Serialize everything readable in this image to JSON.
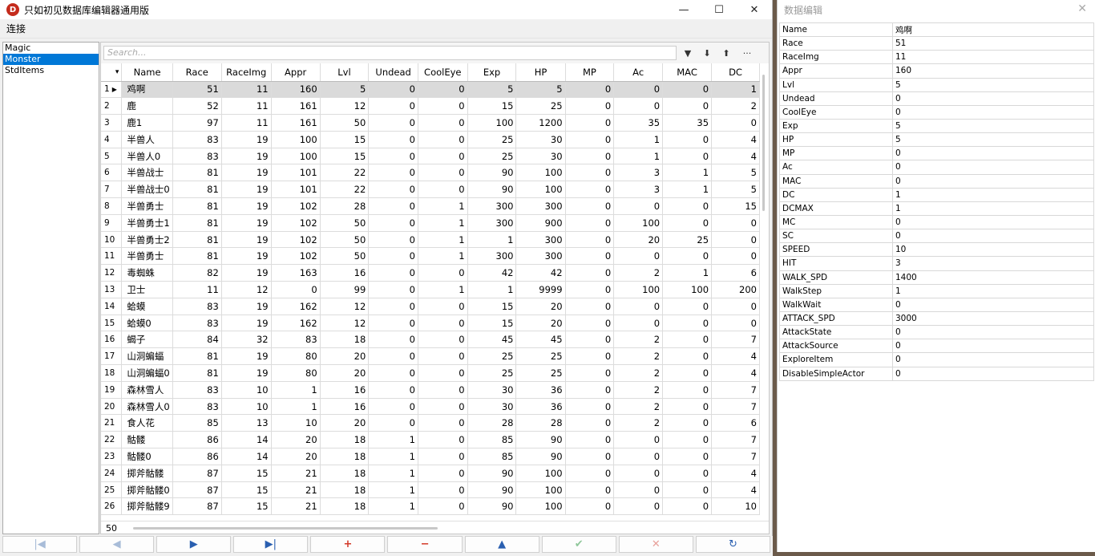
{
  "window": {
    "icon_letter": "D",
    "title": "只如初见数据库编辑器通用版",
    "minimize": "—",
    "maximize": "☐",
    "close": "✕"
  },
  "menu": [
    "连接"
  ],
  "tables": [
    {
      "label": "Magic",
      "selected": false
    },
    {
      "label": "Monster",
      "selected": true
    },
    {
      "label": "StdItems",
      "selected": false
    }
  ],
  "search": {
    "placeholder": "Search..."
  },
  "toolbar": {
    "filter": "▼",
    "sort_desc": "⬇",
    "sort_asc": "⬆",
    "more": "···"
  },
  "grid": {
    "header_corner": "▾",
    "columns": [
      "Name",
      "Race",
      "RaceImg",
      "Appr",
      "Lvl",
      "Undead",
      "CoolEye",
      "Exp",
      "HP",
      "MP",
      "Ac",
      "MAC",
      "DC"
    ],
    "selected_row": 1,
    "rows": [
      [
        "1",
        "鸡啊",
        "51",
        "11",
        "160",
        "5",
        "0",
        "0",
        "5",
        "5",
        "0",
        "0",
        "0",
        "1"
      ],
      [
        "2",
        "鹿",
        "52",
        "11",
        "161",
        "12",
        "0",
        "0",
        "15",
        "25",
        "0",
        "0",
        "0",
        "2"
      ],
      [
        "3",
        "鹿1",
        "97",
        "11",
        "161",
        "50",
        "0",
        "0",
        "100",
        "1200",
        "0",
        "35",
        "35",
        "0"
      ],
      [
        "4",
        "半兽人",
        "83",
        "19",
        "100",
        "15",
        "0",
        "0",
        "25",
        "30",
        "0",
        "1",
        "0",
        "4"
      ],
      [
        "5",
        "半兽人0",
        "83",
        "19",
        "100",
        "15",
        "0",
        "0",
        "25",
        "30",
        "0",
        "1",
        "0",
        "4"
      ],
      [
        "6",
        "半兽战士",
        "81",
        "19",
        "101",
        "22",
        "0",
        "0",
        "90",
        "100",
        "0",
        "3",
        "1",
        "5"
      ],
      [
        "7",
        "半兽战士0",
        "81",
        "19",
        "101",
        "22",
        "0",
        "0",
        "90",
        "100",
        "0",
        "3",
        "1",
        "5"
      ],
      [
        "8",
        "半兽勇士",
        "81",
        "19",
        "102",
        "28",
        "0",
        "1",
        "300",
        "300",
        "0",
        "0",
        "0",
        "15"
      ],
      [
        "9",
        "半兽勇士1",
        "81",
        "19",
        "102",
        "50",
        "0",
        "1",
        "300",
        "900",
        "0",
        "100",
        "0",
        "0"
      ],
      [
        "10",
        "半兽勇士2",
        "81",
        "19",
        "102",
        "50",
        "0",
        "1",
        "1",
        "300",
        "0",
        "20",
        "25",
        "0"
      ],
      [
        "11",
        "半兽勇士",
        "81",
        "19",
        "102",
        "50",
        "0",
        "1",
        "300",
        "300",
        "0",
        "0",
        "0",
        "0"
      ],
      [
        "12",
        "毒蜘蛛",
        "82",
        "19",
        "163",
        "16",
        "0",
        "0",
        "42",
        "42",
        "0",
        "2",
        "1",
        "6"
      ],
      [
        "13",
        "卫士",
        "11",
        "12",
        "0",
        "99",
        "0",
        "1",
        "1",
        "9999",
        "0",
        "100",
        "100",
        "200"
      ],
      [
        "14",
        "蛤蟆",
        "83",
        "19",
        "162",
        "12",
        "0",
        "0",
        "15",
        "20",
        "0",
        "0",
        "0",
        "0"
      ],
      [
        "15",
        "蛤蟆0",
        "83",
        "19",
        "162",
        "12",
        "0",
        "0",
        "15",
        "20",
        "0",
        "0",
        "0",
        "0"
      ],
      [
        "16",
        "蝎子",
        "84",
        "32",
        "83",
        "18",
        "0",
        "0",
        "45",
        "45",
        "0",
        "2",
        "0",
        "7"
      ],
      [
        "17",
        "山洞蝙蝠",
        "81",
        "19",
        "80",
        "20",
        "0",
        "0",
        "25",
        "25",
        "0",
        "2",
        "0",
        "4"
      ],
      [
        "18",
        "山洞蝙蝠0",
        "81",
        "19",
        "80",
        "20",
        "0",
        "0",
        "25",
        "25",
        "0",
        "2",
        "0",
        "4"
      ],
      [
        "19",
        "森林雪人",
        "83",
        "10",
        "1",
        "16",
        "0",
        "0",
        "30",
        "36",
        "0",
        "2",
        "0",
        "7"
      ],
      [
        "20",
        "森林雪人0",
        "83",
        "10",
        "1",
        "16",
        "0",
        "0",
        "30",
        "36",
        "0",
        "2",
        "0",
        "7"
      ],
      [
        "21",
        "食人花",
        "85",
        "13",
        "10",
        "20",
        "0",
        "0",
        "28",
        "28",
        "0",
        "2",
        "0",
        "6"
      ],
      [
        "22",
        "骷髅",
        "86",
        "14",
        "20",
        "18",
        "1",
        "0",
        "85",
        "90",
        "0",
        "0",
        "0",
        "7"
      ],
      [
        "23",
        "骷髅0",
        "86",
        "14",
        "20",
        "18",
        "1",
        "0",
        "85",
        "90",
        "0",
        "0",
        "0",
        "7"
      ],
      [
        "24",
        "掷斧骷髅",
        "87",
        "15",
        "21",
        "18",
        "1",
        "0",
        "90",
        "100",
        "0",
        "0",
        "0",
        "4"
      ],
      [
        "25",
        "掷斧骷髅0",
        "87",
        "15",
        "21",
        "18",
        "1",
        "0",
        "90",
        "100",
        "0",
        "0",
        "0",
        "4"
      ],
      [
        "26",
        "掷斧骷髅9",
        "87",
        "15",
        "21",
        "18",
        "1",
        "0",
        "90",
        "100",
        "0",
        "0",
        "0",
        "10"
      ]
    ]
  },
  "footer": {
    "record_count": "50"
  },
  "navigator": [
    {
      "name": "first",
      "glyph": "|◀",
      "style": "dim"
    },
    {
      "name": "prior",
      "glyph": "◀",
      "style": "dim"
    },
    {
      "name": "next",
      "glyph": "▶",
      "style": "blue"
    },
    {
      "name": "last",
      "glyph": "▶|",
      "style": "blue"
    },
    {
      "name": "insert",
      "glyph": "+",
      "style": "red"
    },
    {
      "name": "delete",
      "glyph": "−",
      "style": "red"
    },
    {
      "name": "edit",
      "glyph": "▲",
      "style": "blue"
    },
    {
      "name": "post",
      "glyph": "✔",
      "style": "green"
    },
    {
      "name": "cancel",
      "glyph": "✕",
      "style": "pink"
    },
    {
      "name": "refresh",
      "glyph": "↻",
      "style": "blue"
    }
  ],
  "property_window": {
    "title": "数据编辑",
    "close": "✕",
    "fields": [
      [
        "Name",
        "鸡啊"
      ],
      [
        "Race",
        "51"
      ],
      [
        "RaceImg",
        "11"
      ],
      [
        "Appr",
        "160"
      ],
      [
        "Lvl",
        "5"
      ],
      [
        "Undead",
        "0"
      ],
      [
        "CoolEye",
        "0"
      ],
      [
        "Exp",
        "5"
      ],
      [
        "HP",
        "5"
      ],
      [
        "MP",
        "0"
      ],
      [
        "Ac",
        "0"
      ],
      [
        "MAC",
        "0"
      ],
      [
        "DC",
        "1"
      ],
      [
        "DCMAX",
        "1"
      ],
      [
        "MC",
        "0"
      ],
      [
        "SC",
        "0"
      ],
      [
        "SPEED",
        "10"
      ],
      [
        "HIT",
        "3"
      ],
      [
        "WALK_SPD",
        "1400"
      ],
      [
        "WalkStep",
        "1"
      ],
      [
        "WalkWait",
        "0"
      ],
      [
        "ATTACK_SPD",
        "3000"
      ],
      [
        "AttackState",
        "0"
      ],
      [
        "AttackSource",
        "0"
      ],
      [
        "ExploreItem",
        "0"
      ],
      [
        "DisableSimpleActor",
        "0"
      ]
    ]
  }
}
